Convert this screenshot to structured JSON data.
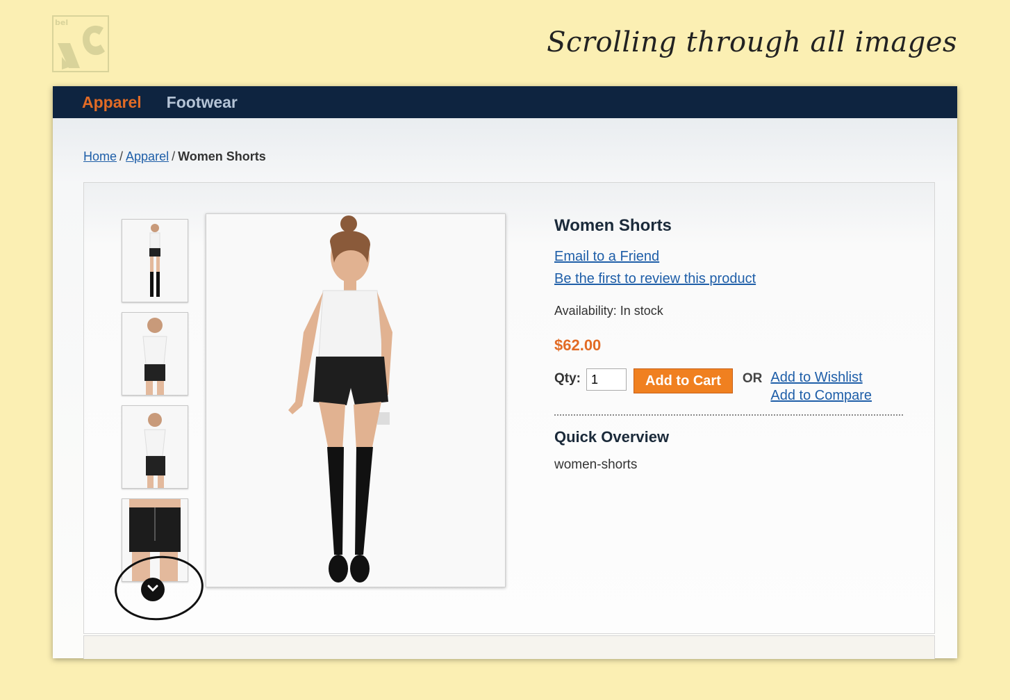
{
  "caption": "Scrolling through all images",
  "logo": {
    "icon": "belvg-logo-icon",
    "color": "#d9d39a"
  },
  "nav": {
    "items": [
      "Apparel",
      "Footwear"
    ],
    "active_index": 0
  },
  "breadcrumb": {
    "home": "Home",
    "sep": "/",
    "category": "Apparel",
    "current": "Women Shorts"
  },
  "product": {
    "name": "Women Shorts",
    "email_link": "Email to a Friend",
    "review_link": "Be the first to review this product",
    "availability": "Availability: In stock",
    "price": "$62.00",
    "qty_label": "Qty:",
    "qty_value": "1",
    "add_to_cart": "Add to Cart",
    "or": "OR",
    "wishlist": "Add to Wishlist",
    "compare": "Add to Compare",
    "overview_title": "Quick Overview",
    "overview_text": "women-shorts"
  },
  "gallery": {
    "thumbnails": [
      "thumb-full-body-front",
      "thumb-hand-on-hip",
      "thumb-waist-up",
      "thumb-shorts-closeup"
    ],
    "scroll_icon": "chevron-down-icon"
  },
  "colors": {
    "nav_bg": "#0e2440",
    "accent": "#e26b25",
    "link": "#1e5ea8",
    "cart_button": "#f08020",
    "page_bg": "#fbefb3"
  }
}
